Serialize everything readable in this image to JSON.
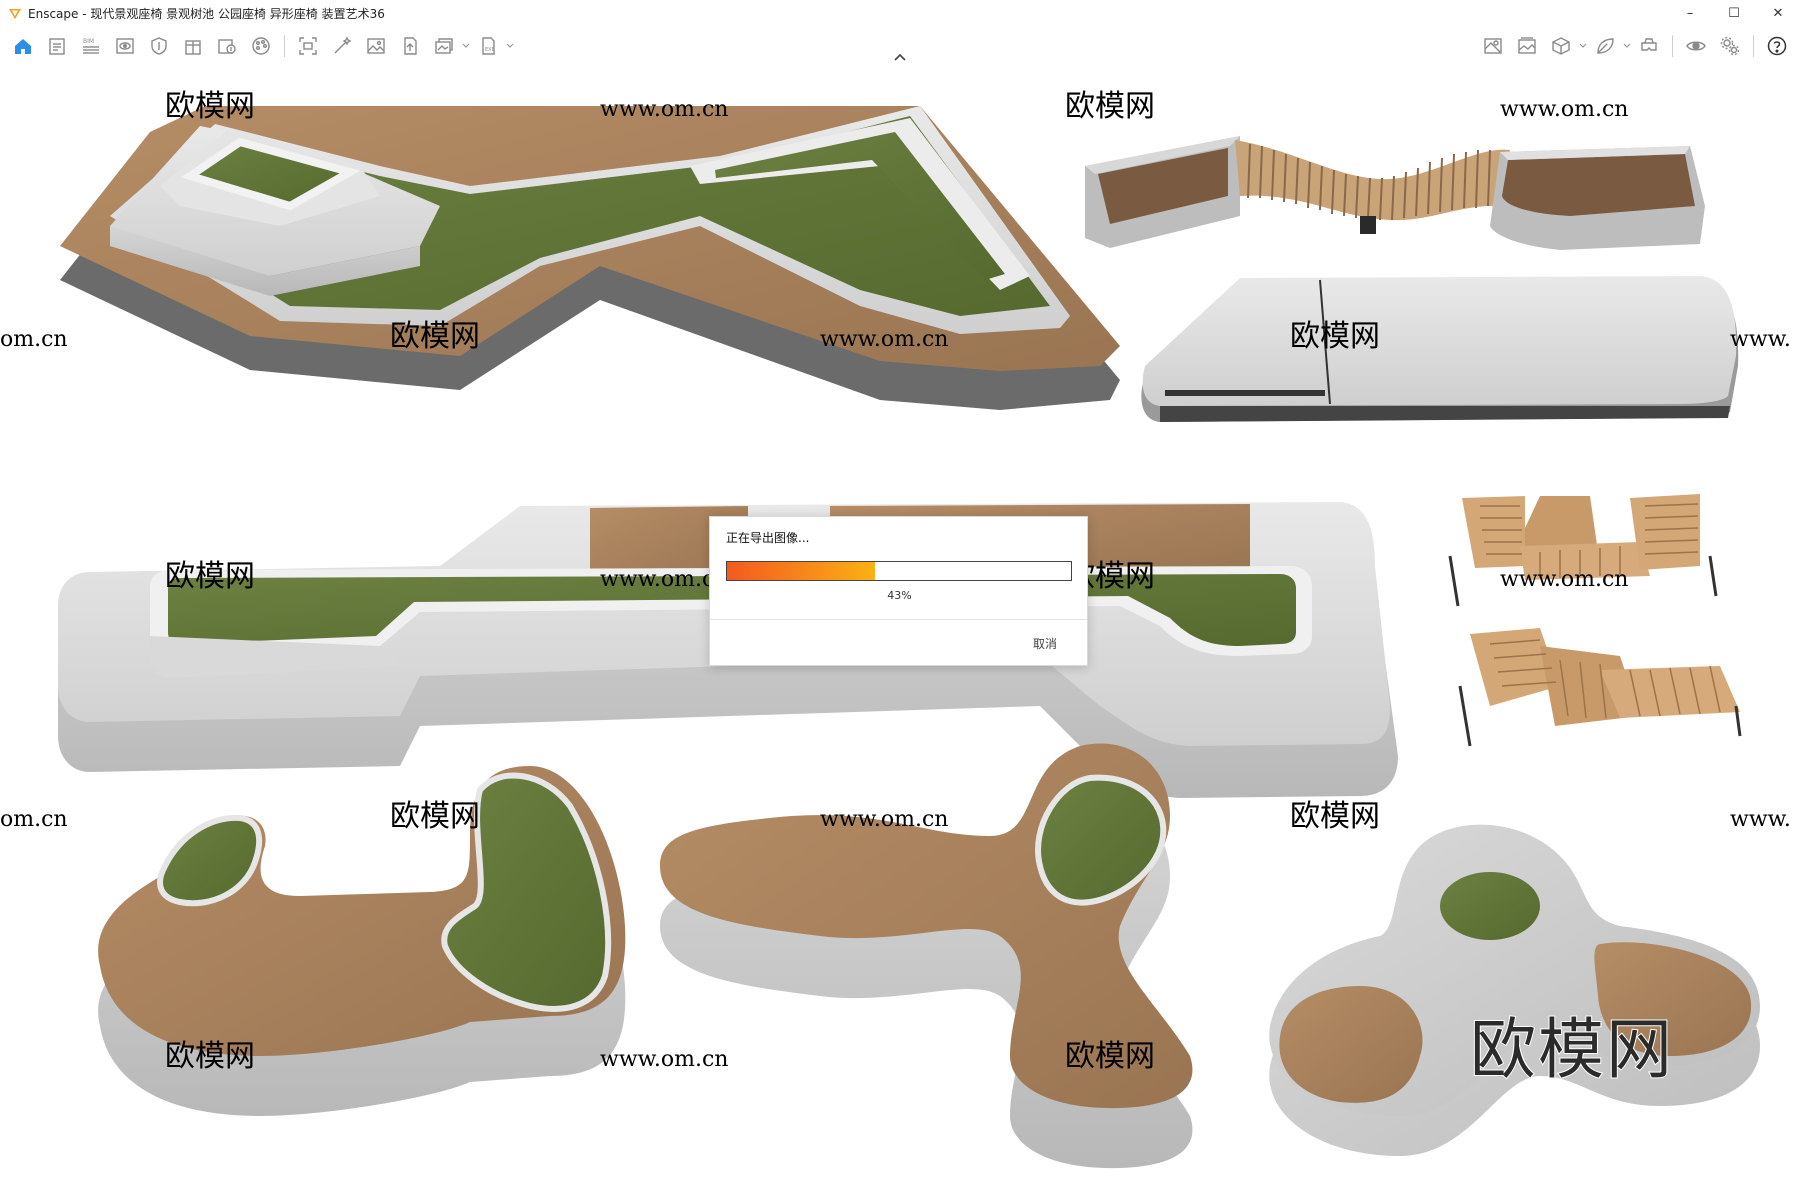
{
  "window": {
    "title": "Enscape - 现代景观座椅 景观树池 公园座椅 异形座椅 装置艺术36",
    "controls": {
      "minimize": "–",
      "maximize": "☐",
      "close": "✕"
    }
  },
  "toolbar": {
    "left_icons": [
      "home-icon",
      "project-icon",
      "bim-icon",
      "view-icon",
      "shield-icon",
      "building-icon",
      "info-icon",
      "palette-icon",
      "screenshot-icon",
      "magic-wand-icon",
      "image-icon",
      "upload-icon",
      "batch-icon",
      "export-icon"
    ],
    "right_icons": [
      "map-icon",
      "gallery-icon",
      "cube-icon",
      "leaf-icon",
      "vr-headset-icon",
      "eye-icon",
      "settings-icon",
      "help-icon"
    ]
  },
  "watermark": {
    "brand": "欧模网",
    "url": "www.om.cn",
    "url_short": "om.cn",
    "url_www": "www."
  },
  "export_dialog": {
    "title": "正在导出图像...",
    "progress": 43,
    "percent_label": "43%",
    "cancel_label": "取消"
  },
  "colors": {
    "wood": "#a9835e",
    "grass": "#62773a",
    "stone": "#d8d8d8",
    "progress_start": "#f45a1e",
    "progress_end": "#fbb212"
  }
}
